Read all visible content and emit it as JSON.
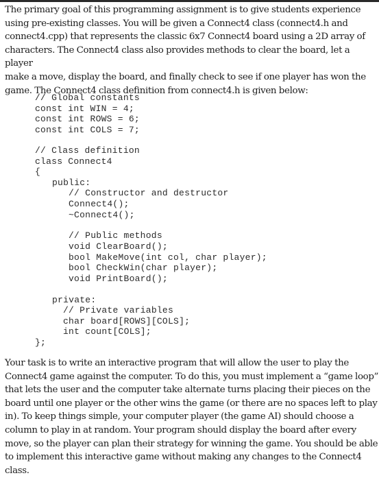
{
  "document": {
    "intro_paragraph": "The primary goal of this programming assignment is to give students experience\nusing pre-existing classes. You will be given a Connect4 class (connect4.h and\nconnect4.cpp) that represents the classic 6x7 Connect4 board using a 2D array of\ncharacters. The Connect4 class also provides methods to clear the board, let a player\nmake a move, display the board, and finally check to see if one player has won the\ngame. The Connect4 class definition from connect4.h is given below:",
    "code": {
      "global_comment": "// Global constants",
      "const_win": "const int WIN = 4;",
      "const_rows": "const int ROWS = 6;",
      "const_cols": "const int COLS = 7;",
      "class_comment": "// Class definition",
      "class_decl": "class Connect4",
      "open_brace": "{",
      "public_label": "public:",
      "ctor_comment": "// Constructor and destructor",
      "ctor": "Connect4();",
      "dtor": "~Connect4();",
      "methods_comment": "// Public methods",
      "method_clear": "void ClearBoard();",
      "method_move": "bool MakeMove(int col, char player);",
      "method_checkwin": "bool CheckWin(char player);",
      "method_print": "void PrintBoard();",
      "private_label": "private:",
      "private_comment": "// Private variables",
      "var_board": "char board[ROWS][COLS];",
      "var_count": "int count[COLS];",
      "close_brace": "};"
    },
    "task_paragraph": "Your task is to write an interactive program that will allow the user to play the\nConnect4 game against the computer. To do this, you must implement a “game loop”\nthat lets the user and the computer take alternate turns placing their pieces on the\nboard until one player or the other wins the game (or there are no spaces left to play\nin). To keep things simple, your computer player (the game AI) should choose a\ncolumn to play in at random. Your program should display the board after every\nmove, so the player can plan their strategy for winning the game. You should be able\nto implement this interactive game without making any changes to the Connect4\nclass."
  }
}
